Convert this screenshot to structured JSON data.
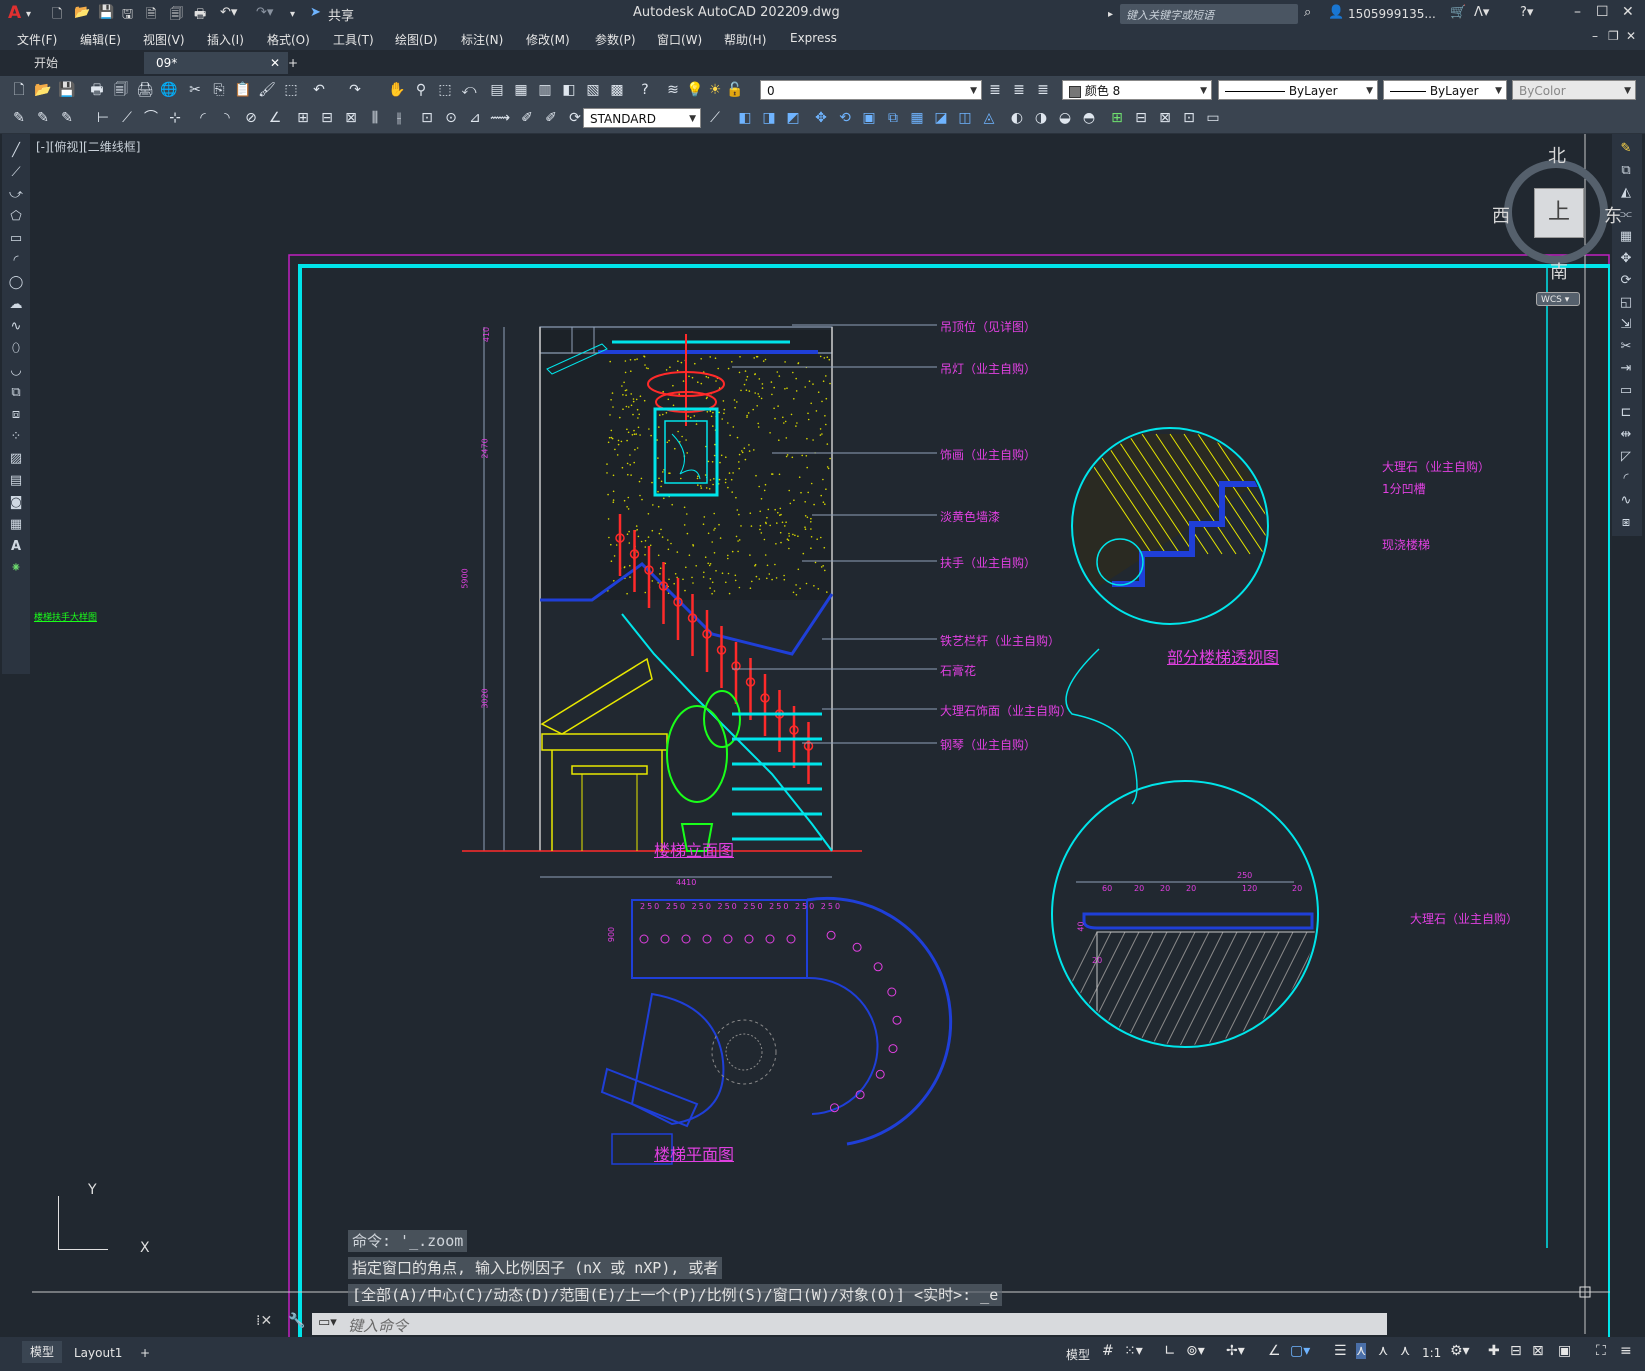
{
  "app": {
    "title": "Autodesk AutoCAD 2022",
    "file": "09.dwg",
    "share_label": "共享",
    "search_placeholder": "键入关键字或短语",
    "user": "1505999135...",
    "logo_letter": "A"
  },
  "menu": [
    "文件(F)",
    "编辑(E)",
    "视图(V)",
    "插入(I)",
    "格式(O)",
    "工具(T)",
    "绘图(D)",
    "标注(N)",
    "修改(M)",
    "参数(P)",
    "窗口(W)",
    "帮助(H)",
    "Express"
  ],
  "tabs": {
    "start": "开始",
    "active": "09*",
    "add": "+"
  },
  "toolbar": {
    "layer_value": "0",
    "color_value": "颜色 8",
    "linetype_value": "ByLayer",
    "lineweight_value": "ByLayer",
    "plotstyle_value": "ByColor",
    "textstyle_value": "STANDARD"
  },
  "viewport": {
    "label": "[-][俯视][二维线框]"
  },
  "viewcube": {
    "north": "北",
    "south": "南",
    "east": "东",
    "west": "西",
    "top": "上",
    "wcs": "WCS"
  },
  "drawing": {
    "elevation_title": "楼梯立面图",
    "plan_title": "楼梯平面图",
    "perspective_title": "部分楼梯透视图",
    "callouts": [
      "吊顶位（见详图）",
      "吊灯（业主自购）",
      "饰画（业主自购）",
      "淡黄色墙漆",
      "扶手（业主自购）",
      "铁艺栏杆（业主自购）",
      "石膏花",
      "大理石饰面（业主自购）",
      "钢琴（业主自购）"
    ],
    "detail_callouts": [
      "大理石（业主自购）",
      "1分凹槽",
      "现浇楼梯"
    ],
    "detail2_callout": "大理石（业主自购）",
    "dims_vertical": [
      "410",
      "2470",
      "5900",
      "3020"
    ],
    "dim_bottom": "4410",
    "plan_dims_top": [
      "250",
      "250",
      "250",
      "250",
      "250",
      "250",
      "250",
      "250"
    ],
    "plan_dim_side": "900",
    "detail_dims": [
      "250",
      "60",
      "20",
      "20",
      "20",
      "120",
      "20",
      "40",
      "20"
    ],
    "left_partial": "楼梯扶手大样图",
    "axis_y": "Y",
    "axis_x": "X"
  },
  "command": {
    "line1": "命令: '_.zoom",
    "line2": "指定窗口的角点, 输入比例因子 (nX 或 nXP), 或者",
    "line3": "[全部(A)/中心(C)/动态(D)/范围(E)/上一个(P)/比例(S)/窗口(W)/对象(O)] <实时>: _e",
    "placeholder": "键入命令"
  },
  "status": {
    "tab_model": "模型",
    "tab_layout": "Layout1",
    "add": "+",
    "model_btn": "模型",
    "scale": "1:1"
  },
  "colors": {
    "cyan": "#00e5ea",
    "magenta": "#e040e0",
    "red": "#ff1a1a",
    "yellow": "#e8e800",
    "blue": "#1f3fd8",
    "green": "#1aff1a"
  }
}
